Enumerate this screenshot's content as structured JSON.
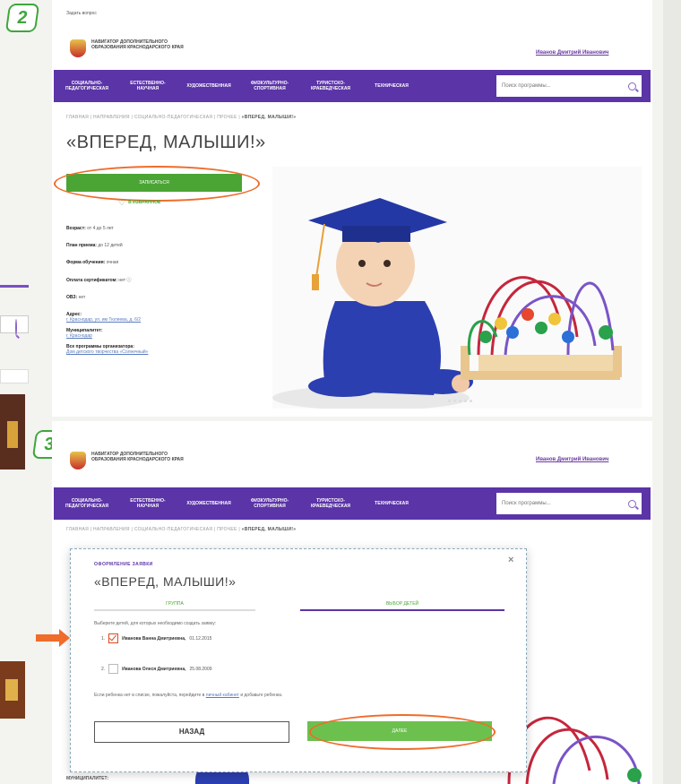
{
  "badges": {
    "step2": "2",
    "step3": "3"
  },
  "top_link": "Задать вопрос",
  "header": {
    "logo_text": "НАВИГАТОР ДОПОЛНИТЕЛЬНОГО ОБРАЗОВАНИЯ КРАСНОДАРСКОГО КРАЯ",
    "user_name": "Иванов Дмитрий Иванович"
  },
  "nav": {
    "items": [
      "СОЦИАЛЬНО-ПЕДАГОГИЧЕСКАЯ",
      "ЕСТЕСТВЕННО-НАУЧНАЯ",
      "ХУДОЖЕСТВЕННАЯ",
      "ФИЗКУЛЬТУРНО-СПОРТИВНАЯ",
      "ТУРИСТСКО-КРАЕВЕДЧЕСКАЯ",
      "ТЕХНИЧЕСКАЯ"
    ],
    "search_placeholder": "Поиск программы..."
  },
  "breadcrumb": {
    "path": "ГЛАВНАЯ | НАПРАВЛЕНИЯ | СОЦИАЛЬНО-ПЕДАГОГИЧЕСКАЯ | ПРОЧЕЕ |",
    "current": "«ВПЕРЕД, МАЛЫШИ!»"
  },
  "program": {
    "title": "«ВПЕРЕД, МАЛЫШИ!»",
    "enroll_button": "ЗАПИСАТЬСЯ",
    "favorite_label": "В ИЗБРАННОЕ",
    "info": [
      {
        "label": "Возраст:",
        "value": "от 4 до 5 лет"
      },
      {
        "label": "План приема:",
        "value": "до 12 детей"
      },
      {
        "label": "Форма обучения:",
        "value": "очная"
      },
      {
        "label": "Оплата сертификатом:",
        "value": "нет"
      },
      {
        "label": "ОВЗ:",
        "value": "нет"
      }
    ],
    "address_label": "Адрес:",
    "address_value": "г. Краснодар, ул. им Тюляева, д. 6/2",
    "municipality_label": "Муниципалитет:",
    "municipality_value": "г. Краснодар",
    "org_label": "Все программы организатора:",
    "org_value": "Дом детского творчества «Солнечный»"
  },
  "modal": {
    "label": "ОФОРМЛЕНИЕ ЗАЯВКИ",
    "title": "«ВПЕРЕД, МАЛЫШИ!»",
    "tab1": "ГРУППА",
    "tab2": "ВЫБОР ДЕТЕЙ",
    "hint": "Выберите детей, для которых необходимо создать заявку:",
    "children": [
      {
        "num": "1.",
        "name": "Иванова Ванна Дмитриевна,",
        "date": "01.12.2015",
        "checked": true
      },
      {
        "num": "2.",
        "name": "Иванова Олеся Дмитриевна,",
        "date": "25.08.2009",
        "checked": false
      }
    ],
    "note_start": "Если ребенка нет в списке, пожалуйста, перейдите в",
    "note_link": "личный кабинет",
    "note_end": "и добавьте ребенка.",
    "back_button": "НАЗАД",
    "next_button": "ДАЛЕЕ"
  },
  "bottom_label": "МУНИЦИПАЛИТЕТ:",
  "colors": {
    "brand_purple": "#5b34a7",
    "accent_green": "#4aa534",
    "highlight_orange": "#ef6c2a"
  }
}
